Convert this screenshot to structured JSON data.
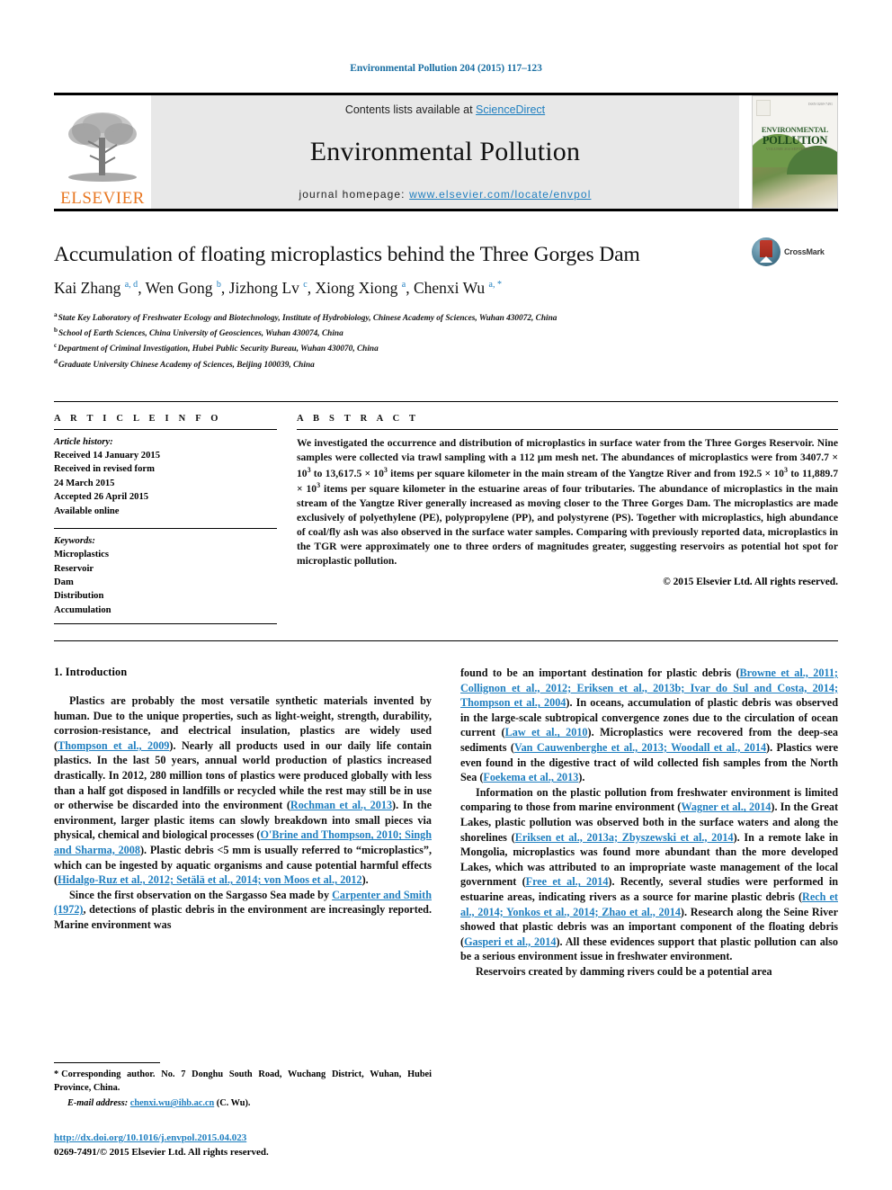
{
  "running_head": "Environmental Pollution 204 (2015) 117–123",
  "masthead": {
    "contents_prefix": "Contents lists available at ",
    "sciencedirect": "ScienceDirect",
    "journal_title": "Environmental Pollution",
    "homepage_prefix": "journal homepage: ",
    "homepage_url": "www.elsevier.com/locate/envpol",
    "publisher_logo_text": "ELSEVIER",
    "cover": {
      "title_line1": "ENVIRONMENTAL",
      "title_line2": "POLLUTION",
      "subtitle": "VOLUME 204  SEPTEMBER 2015",
      "issn": "ISSN 0269-7491"
    },
    "accent_link_color": "#1f7fc0",
    "band_color": "#e8e8e8"
  },
  "article": {
    "title": "Accumulation of floating microplastics behind the Three Gorges Dam",
    "crossmark_label": "CrossMark",
    "authors": [
      {
        "name": "Kai Zhang",
        "sup": "a, d",
        "sep": ", "
      },
      {
        "name": "Wen Gong",
        "sup": "b",
        "sep": ", "
      },
      {
        "name": "Jizhong Lv",
        "sup": "c",
        "sep": ", "
      },
      {
        "name": "Xiong Xiong",
        "sup": "a",
        "sep": ", "
      },
      {
        "name": "Chenxi Wu",
        "sup": "a, *",
        "sep": ""
      }
    ],
    "affiliations": [
      {
        "marker": "a",
        "text": "State Key Laboratory of Freshwater Ecology and Biotechnology, Institute of Hydrobiology, Chinese Academy of Sciences, Wuhan 430072, China"
      },
      {
        "marker": "b",
        "text": "School of Earth Sciences, China University of Geosciences, Wuhan 430074, China"
      },
      {
        "marker": "c",
        "text": "Department of Criminal Investigation, Hubei Public Security Bureau, Wuhan 430070, China"
      },
      {
        "marker": "d",
        "text": "Graduate University Chinese Academy of Sciences, Beijing 100039, China"
      }
    ]
  },
  "article_info": {
    "heading": "A R T I C L E   I N F O",
    "history_heading": "Article history:",
    "history_lines": [
      "Received 14 January 2015",
      "Received in revised form",
      "24 March 2015",
      "Accepted 26 April 2015",
      "Available online"
    ],
    "keywords_heading": "Keywords:",
    "keywords": [
      "Microplastics",
      "Reservoir",
      "Dam",
      "Distribution",
      "Accumulation"
    ]
  },
  "abstract": {
    "heading": "A B S T R A C T",
    "part1": "We investigated the occurrence and distribution of microplastics in surface water from the Three Gorges Reservoir. Nine samples were collected via trawl sampling with a 112 μm mesh net. The abundances of microplastics were from 3407.7 × 10",
    "exp1": "3",
    "part2": " to 13,617.5 × 10",
    "exp2": "3",
    "part3": " items per square kilometer in the main stream of the Yangtze River and from 192.5 × 10",
    "exp3": "3",
    "part4": " to 11,889.7 × 10",
    "exp4": "3",
    "part5": " items per square kilometer in the estuarine areas of four tributaries. The abundance of microplastics in the main stream of the Yangtze River generally increased as moving closer to the Three Gorges Dam. The microplastics are made exclusively of polyethylene (PE), polypropylene (PP), and polystyrene (PS). Together with microplastics, high abundance of coal/fly ash was also observed in the surface water samples. Comparing with previously reported data, microplastics in the TGR were approximately one to three orders of magnitudes greater, suggesting reservoirs as potential hot spot for microplastic pollution.",
    "copyright": "© 2015 Elsevier Ltd. All rights reserved."
  },
  "body": {
    "section_number_title": "1. Introduction",
    "left_paragraphs": [
      {
        "segments": [
          {
            "t": "Plastics are probably the most versatile synthetic materials invented by human. Due to the unique properties, such as light-weight, strength, durability, corrosion-resistance, and electrical insulation, plastics are widely used (",
            "ref": false
          },
          {
            "t": "Thompson et al., 2009",
            "ref": true
          },
          {
            "t": "). Nearly all products used in our daily life contain plastics. In the last 50 years, annual world production of plastics increased drastically. In 2012, 280 million tons of plastics were produced globally with less than a half got disposed in landfills or recycled while the rest may still be in use or otherwise be discarded into the environment (",
            "ref": false
          },
          {
            "t": "Rochman et al., 2013",
            "ref": true
          },
          {
            "t": "). In the environment, larger plastic items can slowly breakdown into small pieces via physical, chemical and biological processes (",
            "ref": false
          },
          {
            "t": "O'Brine and Thompson, 2010; Singh and Sharma, 2008",
            "ref": true
          },
          {
            "t": "). Plastic debris <5 mm is usually referred to “microplastics”, which can be ingested by aquatic organisms and cause potential harmful effects (",
            "ref": false
          },
          {
            "t": "Hidalgo-Ruz et al., 2012; Setälä et al., 2014; von Moos et al., 2012",
            "ref": true
          },
          {
            "t": ").",
            "ref": false
          }
        ]
      },
      {
        "segments": [
          {
            "t": "Since the first observation on the Sargasso Sea made by ",
            "ref": false
          },
          {
            "t": "Carpenter and Smith (1972)",
            "ref": true
          },
          {
            "t": ", detections of plastic debris in the environment are increasingly reported. Marine environment was",
            "ref": false
          }
        ]
      }
    ],
    "right_paragraphs": [
      {
        "segments": [
          {
            "t": "found to be an important destination for plastic debris (",
            "ref": false
          },
          {
            "t": "Browne et al., 2011; Collignon et al., 2012; Eriksen et al., 2013b; Ivar do Sul and Costa, 2014; Thompson et al., 2004",
            "ref": true
          },
          {
            "t": "). In oceans, accumulation of plastic debris was observed in the large-scale subtropical convergence zones due to the circulation of ocean current (",
            "ref": false
          },
          {
            "t": "Law et al., 2010",
            "ref": true
          },
          {
            "t": "). Microplastics were recovered from the deep-sea sediments (",
            "ref": false
          },
          {
            "t": "Van Cauwenberghe et al., 2013; Woodall et al., 2014",
            "ref": true
          },
          {
            "t": "). Plastics were even found in the digestive tract of wild collected fish samples from the North Sea (",
            "ref": false
          },
          {
            "t": "Foekema et al., 2013",
            "ref": true
          },
          {
            "t": ").",
            "ref": false
          }
        ],
        "noindent": true
      },
      {
        "segments": [
          {
            "t": "Information on the plastic pollution from freshwater environment is limited comparing to those from marine environment (",
            "ref": false
          },
          {
            "t": "Wagner et al., 2014",
            "ref": true
          },
          {
            "t": "). In the Great Lakes, plastic pollution was observed both in the surface waters and along the shorelines (",
            "ref": false
          },
          {
            "t": "Eriksen et al., 2013a; Zbyszewski et al., 2014",
            "ref": true
          },
          {
            "t": "). In a remote lake in Mongolia, microplastics was found more abundant than the more developed Lakes, which was attributed to an impropriate waste management of the local government (",
            "ref": false
          },
          {
            "t": "Free et al., 2014",
            "ref": true
          },
          {
            "t": "). Recently, several studies were performed in estuarine areas, indicating rivers as a source for marine plastic debris (",
            "ref": false
          },
          {
            "t": "Rech et al., 2014; Yonkos et al., 2014; Zhao et al., 2014",
            "ref": true
          },
          {
            "t": "). Research along the Seine River showed that plastic debris was an important component of the floating debris (",
            "ref": false
          },
          {
            "t": "Gasperi et al., 2014",
            "ref": true
          },
          {
            "t": "). All these evidences support that plastic pollution can also be a serious environment issue in freshwater environment.",
            "ref": false
          }
        ]
      },
      {
        "segments": [
          {
            "t": "Reservoirs created by damming rivers could be a potential area",
            "ref": false
          }
        ]
      }
    ]
  },
  "footnote": {
    "star": "*",
    "corresponding": "Corresponding author. No. 7 Donghu South Road, Wuchang District, Wuhan, Hubei Province, China.",
    "email_label": "E-mail address:",
    "email": "chenxi.wu@ihb.ac.cn",
    "email_suffix": "(C. Wu)."
  },
  "doi_block": {
    "doi_url": "http://dx.doi.org/10.1016/j.envpol.2015.04.023",
    "issn_line": "0269-7491/© 2015 Elsevier Ltd. All rights reserved."
  }
}
